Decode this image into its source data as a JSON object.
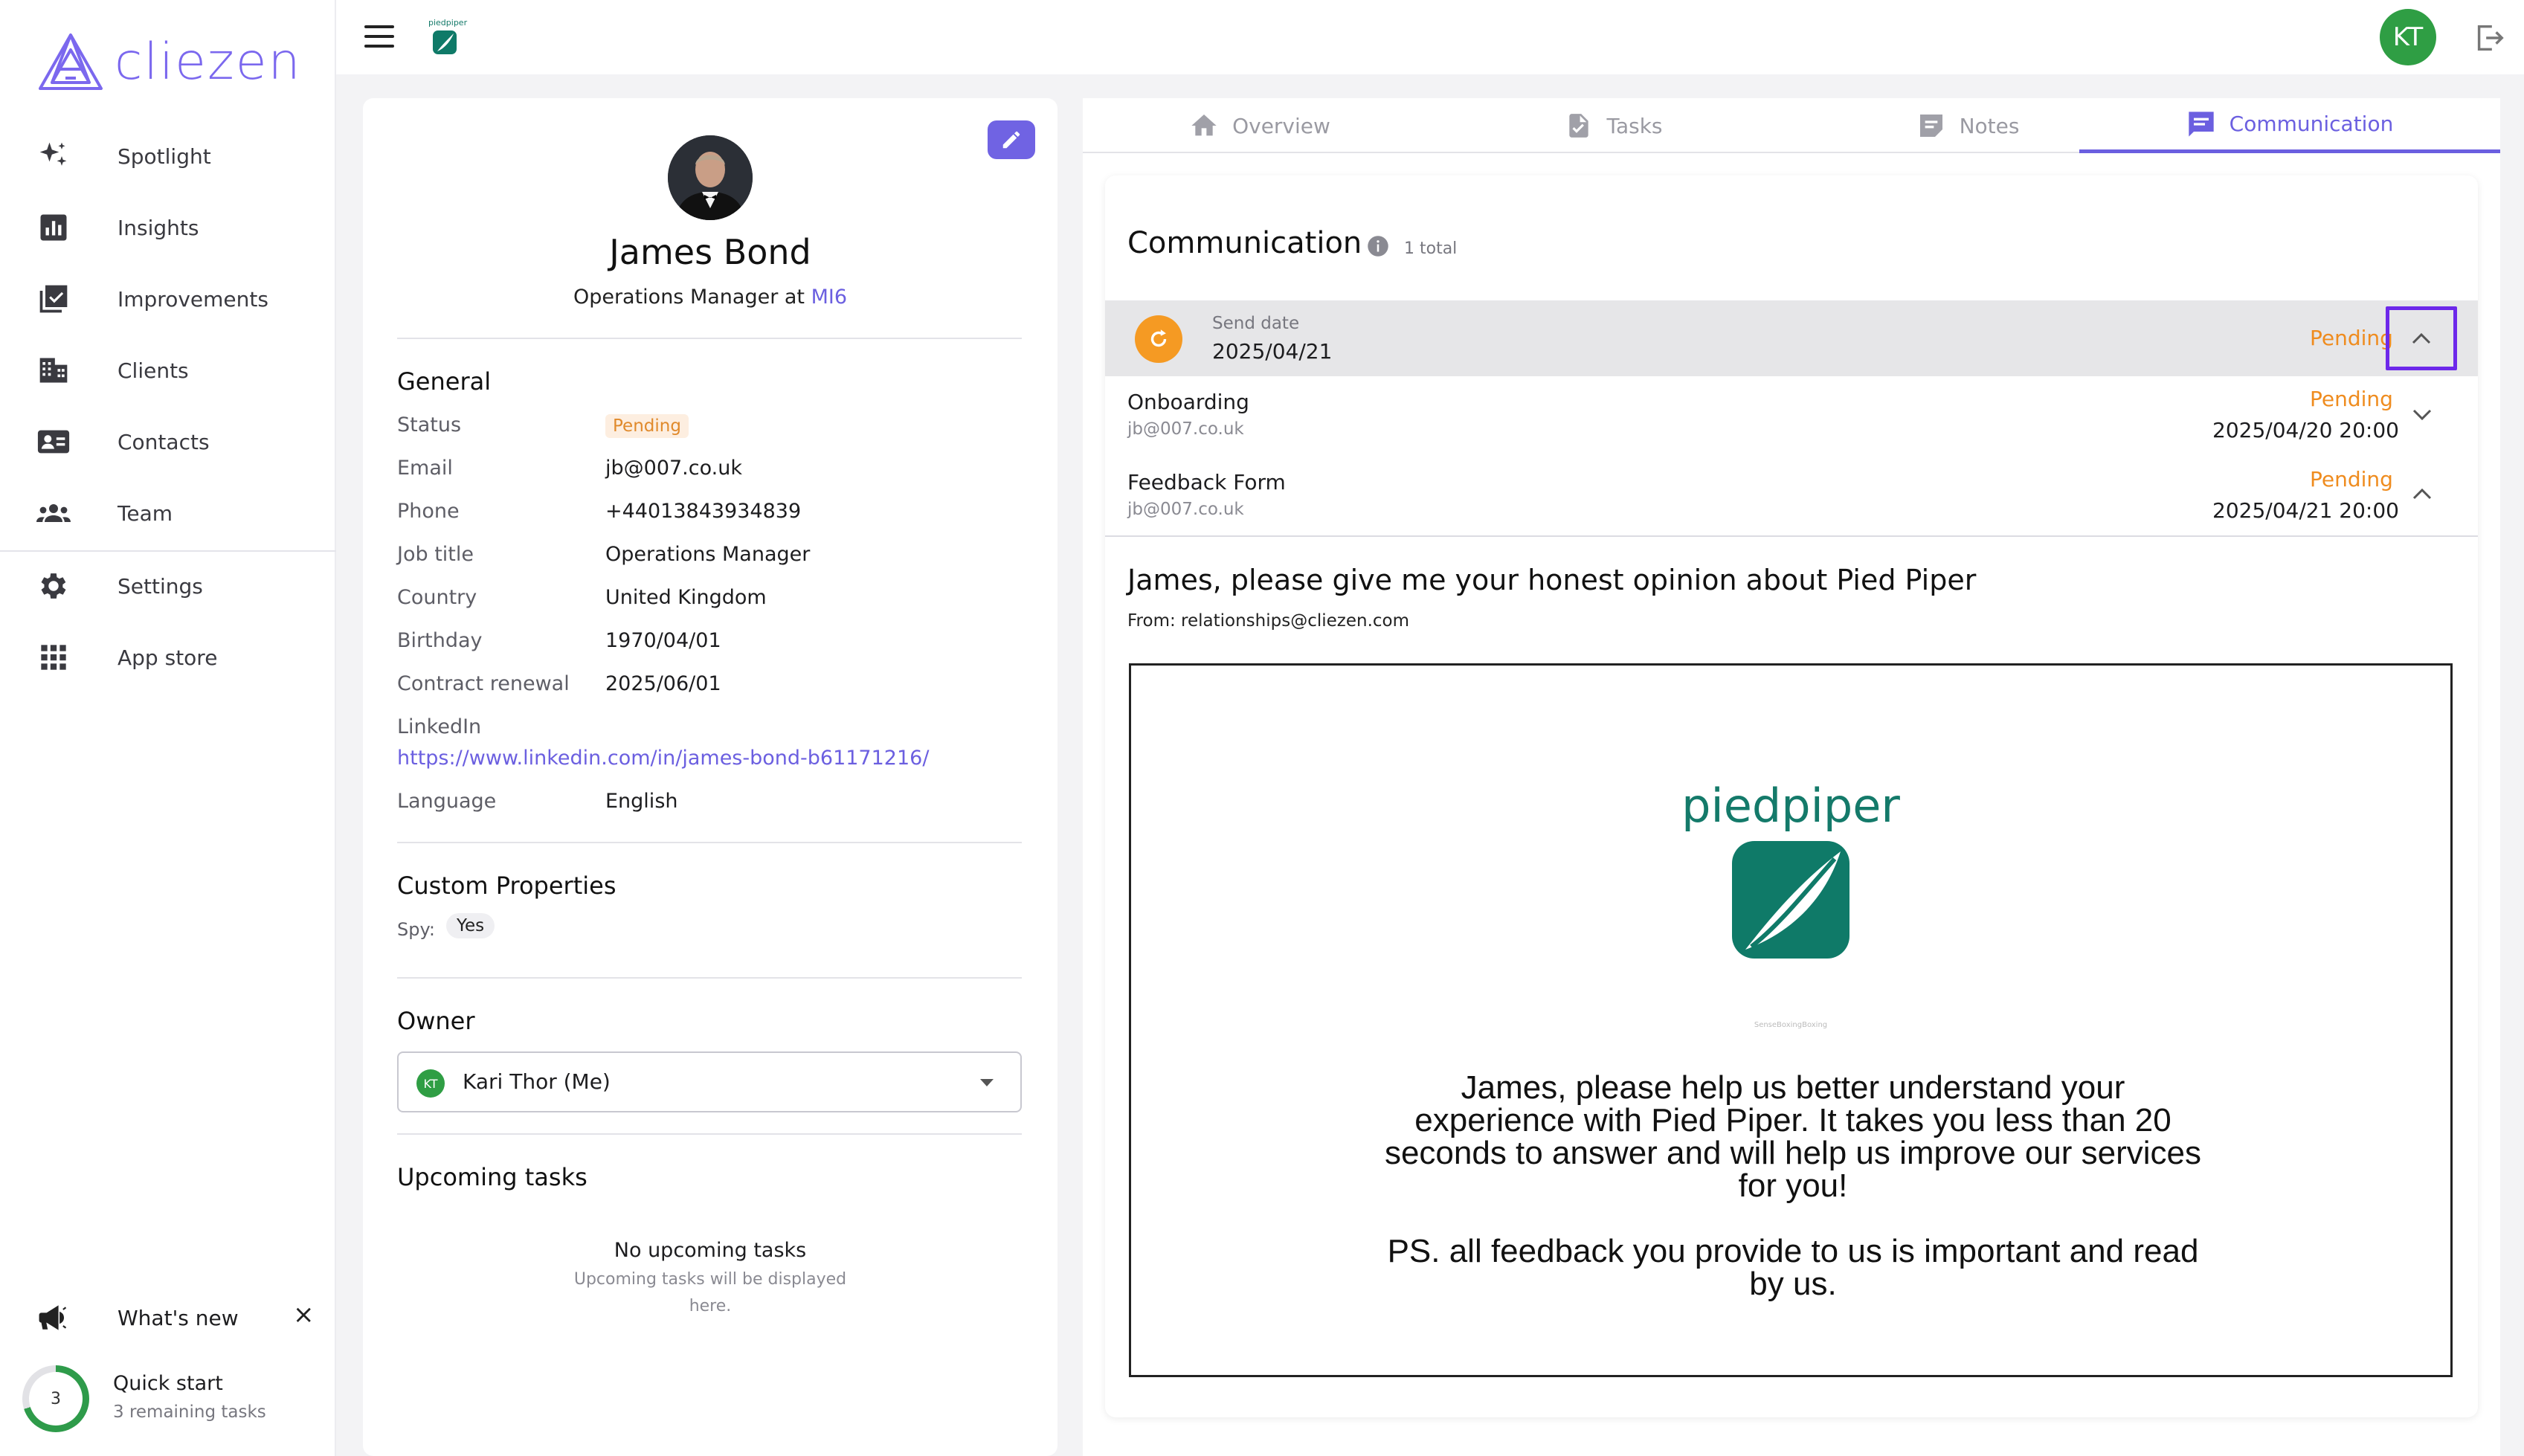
{
  "app": {
    "name": "cliezen",
    "brand_color": "#7b68ee",
    "accent_color": "#6b5fe0",
    "pending_color": "#ef8c1f",
    "success_color": "#2f9e44"
  },
  "sidebar": {
    "items": [
      {
        "label": "Spotlight",
        "icon": "sparkles-icon"
      },
      {
        "label": "Insights",
        "icon": "bar-chart-icon"
      },
      {
        "label": "Improvements",
        "icon": "checklist-icon"
      },
      {
        "label": "Clients",
        "icon": "building-icon"
      },
      {
        "label": "Contacts",
        "icon": "contact-card-icon"
      },
      {
        "label": "Team",
        "icon": "people-icon"
      },
      {
        "label": "Settings",
        "icon": "gear-icon"
      },
      {
        "label": "App store",
        "icon": "grid-icon"
      }
    ],
    "whats_new": {
      "label": "What's new",
      "close": "×"
    },
    "quick_start": {
      "title": "Quick start",
      "subtitle": "3 remaining tasks",
      "count": "3",
      "progress": 0.7
    }
  },
  "topbar": {
    "org_logo_label": "piedpiper",
    "user_initials": "KT"
  },
  "profile": {
    "name": "James Bond",
    "role_prefix": "Operations Manager at ",
    "company": "MI6",
    "general": {
      "title": "General",
      "status_label": "Status",
      "status_value": "Pending",
      "email_label": "Email",
      "email_value": "jb@007.co.uk",
      "phone_label": "Phone",
      "phone_value": "+44013843934839",
      "job_label": "Job title",
      "job_value": "Operations Manager",
      "country_label": "Country",
      "country_value": "United Kingdom",
      "birthday_label": "Birthday",
      "birthday_value": "1970/04/01",
      "renewal_label": "Contract renewal",
      "renewal_value": "2025/06/01",
      "linkedin_label": "LinkedIn",
      "linkedin_value": "https://www.linkedin.com/in/james-bond-b61171216/",
      "language_label": "Language",
      "language_value": "English"
    },
    "custom": {
      "title": "Custom Properties",
      "spy_label": "Spy:",
      "spy_value": "Yes"
    },
    "owner": {
      "title": "Owner",
      "initials": "KT",
      "value": "Kari Thor (Me)"
    },
    "upcoming": {
      "title": "Upcoming tasks",
      "empty_title": "No upcoming tasks",
      "empty_line1": "Upcoming tasks will be displayed",
      "empty_line2": "here."
    }
  },
  "tabs": [
    {
      "label": "Overview",
      "icon": "home-icon"
    },
    {
      "label": "Tasks",
      "icon": "task-file-icon"
    },
    {
      "label": "Notes",
      "icon": "notes-icon"
    },
    {
      "label": "Communication",
      "icon": "chat-icon",
      "active": true
    }
  ],
  "communication": {
    "title": "Communication",
    "total": "1 total",
    "group": {
      "date_label": "Send date",
      "date_value": "2025/04/21",
      "status": "Pending"
    },
    "items": [
      {
        "name": "Onboarding",
        "email": "jb@007.co.uk",
        "status": "Pending",
        "datetime": "2025/04/20 20:00"
      },
      {
        "name": "Feedback Form",
        "email": "jb@007.co.uk",
        "status": "Pending",
        "datetime": "2025/04/21 20:00"
      }
    ],
    "message": {
      "subject": "James, please give me your honest opinion about Pied Piper",
      "from": "From: relationships@cliezen.com",
      "logo_text": "piedpiper",
      "small_caption": "SenseBoxingBoxing",
      "body_line1": "James, please help us better understand your",
      "body_line2": "experience with Pied Piper. It takes you less than 20",
      "body_line3": "seconds to answer and will help us improve our services",
      "body_line4": "for you!",
      "ps_line1": "PS. all feedback you provide to us is important and read",
      "ps_line2": "by us."
    }
  }
}
